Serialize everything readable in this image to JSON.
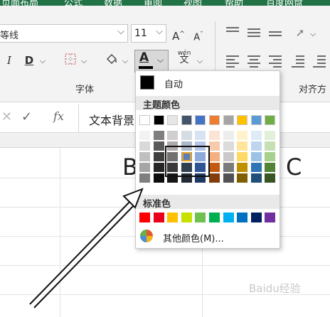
{
  "tabs": [
    "页面布局",
    "公式",
    "数据",
    "审阅",
    "视图",
    "帮助",
    "百度网盘"
  ],
  "font": {
    "name": "等线",
    "size": "11"
  },
  "ribbon": {
    "grow_font": "A",
    "shrink_font": "A",
    "italic": "I",
    "strikethrough": "D",
    "font_color_letter": "A",
    "phonetic": "文",
    "phonetic_top": "wén",
    "group_font_label": "字体",
    "group_align_label": "对齐方"
  },
  "formula_bar": {
    "cancel": "✕",
    "enter": "✓",
    "fx": "fx",
    "value": "文本背景"
  },
  "sheet": {
    "cell_b": "B",
    "cell_c": "C"
  },
  "dropdown": {
    "auto_label": "自动",
    "theme_title": "主题颜色",
    "standard_title": "标准色",
    "more_label": "其他颜色(M)...",
    "theme_top": [
      "#ffffff",
      "#000000",
      "#e7e6e6",
      "#44546a",
      "#4472c4",
      "#ed7d31",
      "#a5a5a5",
      "#ffc000",
      "#5b9bd5",
      "#70ad47"
    ],
    "theme_tints": [
      [
        "#f2f2f2",
        "#7f7f7f",
        "#d0cece",
        "#d6dce4",
        "#d9e2f3",
        "#fbe4d5",
        "#ededed",
        "#fff2cc",
        "#deeaf6",
        "#e2efd9"
      ],
      [
        "#d9d9d9",
        "#595959",
        "#aeaaaa",
        "#adb9ca",
        "#b4c6e7",
        "#f7caac",
        "#dbdbdb",
        "#fee599",
        "#bdd6ee",
        "#c5e0b3"
      ],
      [
        "#bfbfbf",
        "#3f3f3f",
        "#757070",
        "#8496b0",
        "#8eaadb",
        "#f4b083",
        "#c9c9c9",
        "#ffd965",
        "#9cc2e5",
        "#a8d08d"
      ],
      [
        "#a5a5a5",
        "#262626",
        "#3a3838",
        "#323f4f",
        "#2f5496",
        "#c45911",
        "#7b7b7b",
        "#bf9000",
        "#2e75b5",
        "#538135"
      ],
      [
        "#7f7f7f",
        "#0d0d0d",
        "#171616",
        "#222a35",
        "#1f3864",
        "#833c0b",
        "#525252",
        "#7f6000",
        "#1f4e79",
        "#375623"
      ]
    ],
    "standard": [
      "#ff0000",
      "#e8001c",
      "#ffc000",
      "#c8e000",
      "#70c050",
      "#00b050",
      "#00b0f0",
      "#0070c0",
      "#002060",
      "#7030a0"
    ]
  },
  "watermark": "Baidu经验"
}
